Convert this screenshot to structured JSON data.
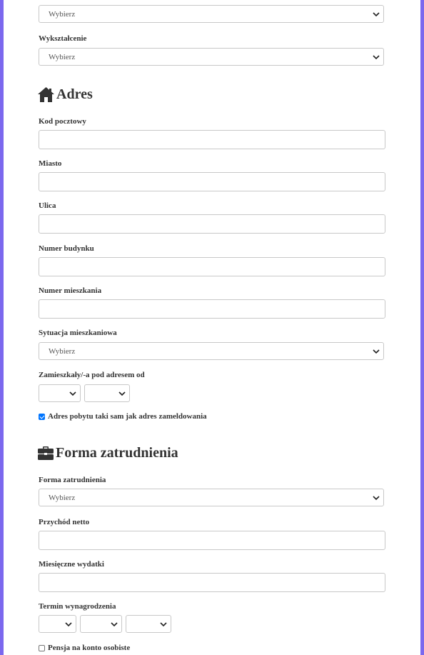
{
  "top_select": {
    "value": "Wybierz"
  },
  "education": {
    "label": "Wykształcenie",
    "value": "Wybierz"
  },
  "address_section": {
    "title": "Adres",
    "icon": "home-icon",
    "postal_code_label": "Kod pocztowy",
    "city_label": "Miasto",
    "street_label": "Ulica",
    "building_label": "Numer budynku",
    "apartment_label": "Numer mieszkania",
    "housing_label": "Sytuacja mieszkaniowa",
    "housing_value": "Wybierz",
    "since_label": "Zamieszkały/-a pod adresem od",
    "same_address_label": "Adres pobytu taki sam jak adres zameldowania",
    "same_address_checked": true
  },
  "employment_section": {
    "title": "Forma zatrudnienia",
    "icon": "briefcase-icon",
    "employment_label": "Forma zatrudnienia",
    "employment_value": "Wybierz",
    "net_income_label": "Przychód netto",
    "expenses_label": "Miesięczne wydatki",
    "salary_date_label": "Termin wynagrodzenia",
    "pension_label": "Pensja na konto osobiste",
    "pension_checked": false
  },
  "colors": {
    "frame": "#7b68ee",
    "text": "#333333",
    "border": "#c8c8c8",
    "checkbox": "#0075ff"
  }
}
